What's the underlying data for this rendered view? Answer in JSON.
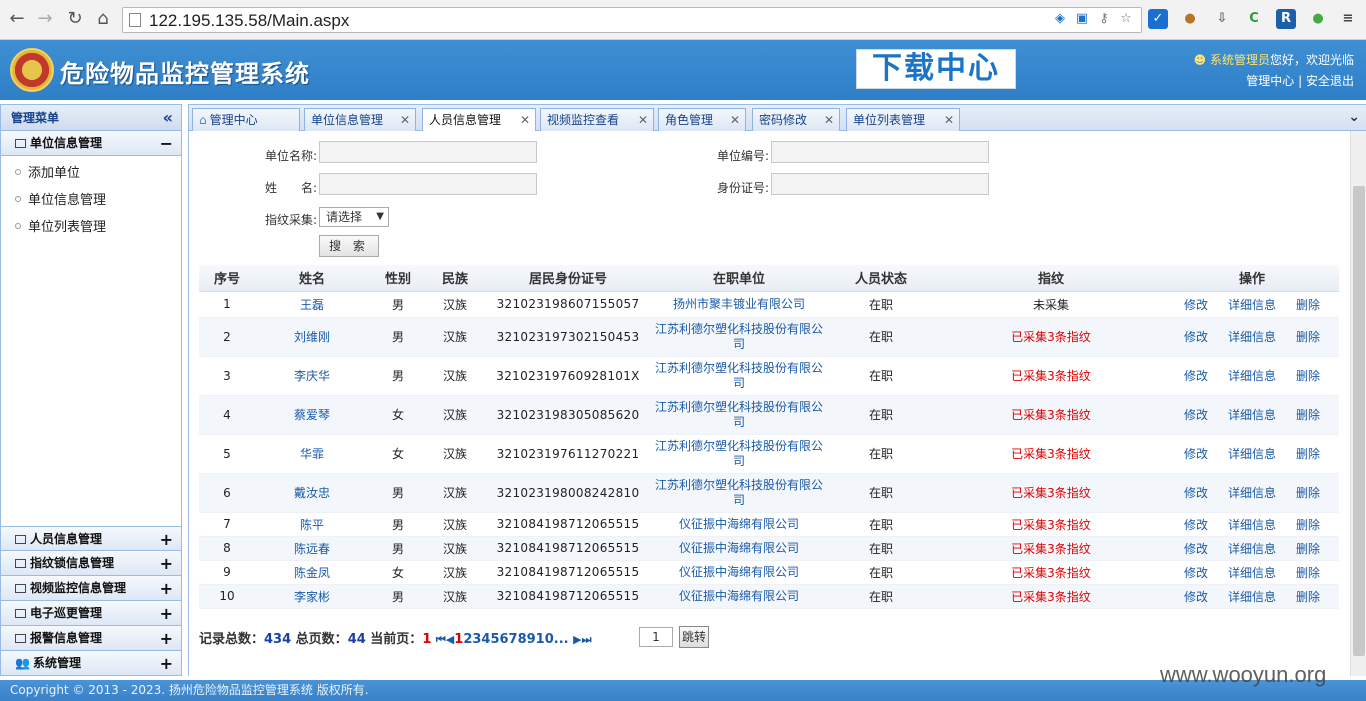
{
  "browser": {
    "url": "122.195.135.58/Main.aspx"
  },
  "header": {
    "title": "危险物品监控管理系统",
    "download_center": "下载中心",
    "user_name": "系统管理员",
    "greeting": "您好，欢迎光临",
    "link_manage": "管理中心",
    "link_sep": "|",
    "link_logout": "安全退出"
  },
  "sidebar": {
    "title": "管理菜单",
    "collapse_glyph": "«",
    "sections": [
      {
        "label": "单位信息管理",
        "toggle": "−"
      },
      {
        "label": "人员信息管理",
        "toggle": "+"
      },
      {
        "label": "指纹锁信息管理",
        "toggle": "+"
      },
      {
        "label": "视频监控信息管理",
        "toggle": "+"
      },
      {
        "label": "电子巡更管理",
        "toggle": "+"
      },
      {
        "label": "报警信息管理",
        "toggle": "+"
      },
      {
        "label": "系统管理",
        "toggle": "+"
      }
    ],
    "sub_items": [
      "添加单位",
      "单位信息管理",
      "单位列表管理"
    ]
  },
  "tabs": [
    {
      "label": "管理中心",
      "closable": false
    },
    {
      "label": "单位信息管理",
      "closable": true
    },
    {
      "label": "人员信息管理",
      "closable": true
    },
    {
      "label": "视频监控查看",
      "closable": true
    },
    {
      "label": "角色管理",
      "closable": true
    },
    {
      "label": "密码修改",
      "closable": true
    },
    {
      "label": "单位列表管理",
      "closable": true
    }
  ],
  "form": {
    "unit_name_label": "单位名称:",
    "name_label": "姓　　名:",
    "fingerprint_label": "指纹采集:",
    "unit_code_label": "单位编号:",
    "id_card_label": "身份证号:",
    "select_value": "请选择",
    "search_button": "搜 索"
  },
  "table": {
    "headers": [
      "序号",
      "姓名",
      "性别",
      "民族",
      "居民身份证号",
      "在职单位",
      "人员状态",
      "指纹",
      "操作"
    ],
    "rows": [
      {
        "no": "1",
        "name": "王磊",
        "gender": "男",
        "ethnicity": "汉族",
        "id": "321023198607155057",
        "unit": "扬州市聚丰镀业有限公司",
        "status": "在职",
        "fingerprint": "未采集",
        "collected": false
      },
      {
        "no": "2",
        "name": "刘维刚",
        "gender": "男",
        "ethnicity": "汉族",
        "id": "321023197302150453",
        "unit": "江苏利德尔塑化科技股份有限公司",
        "status": "在职",
        "fingerprint": "已采集3条指纹",
        "collected": true
      },
      {
        "no": "3",
        "name": "李庆华",
        "gender": "男",
        "ethnicity": "汉族",
        "id": "32102319760928101X",
        "unit": "江苏利德尔塑化科技股份有限公司",
        "status": "在职",
        "fingerprint": "已采集3条指纹",
        "collected": true
      },
      {
        "no": "4",
        "name": "蔡爱琴",
        "gender": "女",
        "ethnicity": "汉族",
        "id": "321023198305085620",
        "unit": "江苏利德尔塑化科技股份有限公司",
        "status": "在职",
        "fingerprint": "已采集3条指纹",
        "collected": true
      },
      {
        "no": "5",
        "name": "华霏",
        "gender": "女",
        "ethnicity": "汉族",
        "id": "321023197611270221",
        "unit": "江苏利德尔塑化科技股份有限公司",
        "status": "在职",
        "fingerprint": "已采集3条指纹",
        "collected": true
      },
      {
        "no": "6",
        "name": "戴汝忠",
        "gender": "男",
        "ethnicity": "汉族",
        "id": "321023198008242810",
        "unit": "江苏利德尔塑化科技股份有限公司",
        "status": "在职",
        "fingerprint": "已采集3条指纹",
        "collected": true
      },
      {
        "no": "7",
        "name": "陈平",
        "gender": "男",
        "ethnicity": "汉族",
        "id": "321084198712065515",
        "unit": "仪征振中海绵有限公司",
        "status": "在职",
        "fingerprint": "已采集3条指纹",
        "collected": true
      },
      {
        "no": "8",
        "name": "陈远春",
        "gender": "男",
        "ethnicity": "汉族",
        "id": "321084198712065515",
        "unit": "仪征振中海绵有限公司",
        "status": "在职",
        "fingerprint": "已采集3条指纹",
        "collected": true
      },
      {
        "no": "9",
        "name": "陈金凤",
        "gender": "女",
        "ethnicity": "汉族",
        "id": "321084198712065515",
        "unit": "仪征振中海绵有限公司",
        "status": "在职",
        "fingerprint": "已采集3条指纹",
        "collected": true
      },
      {
        "no": "10",
        "name": "李家彬",
        "gender": "男",
        "ethnicity": "汉族",
        "id": "321084198712065515",
        "unit": "仪征振中海绵有限公司",
        "status": "在职",
        "fingerprint": "已采集3条指纹",
        "collected": true
      }
    ],
    "ops": [
      "修改",
      "详细信息",
      "删除"
    ]
  },
  "pager": {
    "total_label": "记录总数：",
    "total": "434",
    "pages_label": " 总页数：",
    "pages": "44",
    "current_label": " 当前页：",
    "current": "1",
    "page_links_current": "1",
    "page_links": "2345678910...",
    "input_value": "1",
    "jump_label": "跳转"
  },
  "footer": {
    "text": "Copyright © 2013 - 2023. 扬州危险物品监控管理系统 版权所有."
  },
  "watermark": "www.wooyun.org",
  "colors": {
    "header_blue": "#2f7fc8",
    "link_blue": "#1a5aa8",
    "alert_red": "#dd0000"
  }
}
